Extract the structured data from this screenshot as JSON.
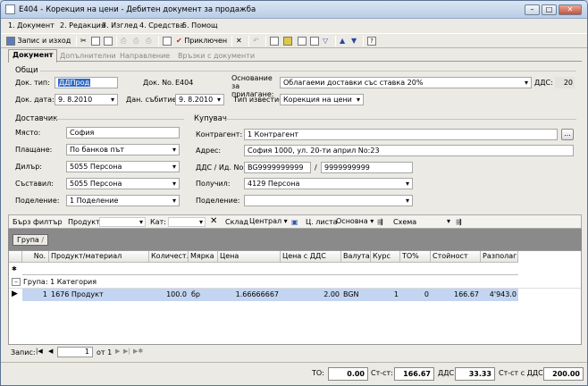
{
  "window": {
    "title": "E404 - Корекция на цени - Дебитен документ за продажба"
  },
  "menu": [
    "1. Документ",
    "2. Редакция",
    "3. Изглед",
    "4. Средства",
    "5. Помощ"
  ],
  "toolbar": {
    "save_exit": "Запис и изход",
    "apply": "Приключен"
  },
  "tabs": [
    "Документ",
    "Допълнителни",
    "Направление",
    "Връзки с документи"
  ],
  "general": {
    "section": "Общи",
    "doc_type_label": "Док. тип:",
    "doc_type_value": "ДДПрод",
    "doc_no_label": "Док. No.",
    "doc_no_value": "E404",
    "basis_label": "Основание за прилагане:",
    "basis_value": "Облагаеми доставки със ставка 20%",
    "vat_label": "ДДС:",
    "vat_value": "20",
    "doc_date_label": "Док. дата:",
    "doc_date_value": "9. 8.2010",
    "event_date_label": "Дан. събитие:",
    "event_date_value": "9. 8.2010",
    "notice_label": "Тип известие:",
    "notice_value": "Корекция на цени"
  },
  "supplier": {
    "section": "Доставчик",
    "place_label": "Място:",
    "place_value": "София",
    "payment_label": "Плащане:",
    "payment_value": "По банков път",
    "dealer_label": "Дилър:",
    "dealer_value": "5055 Персона",
    "compiler_label": "Съставил:",
    "compiler_value": "5055 Персона",
    "division_label": "Поделение:",
    "division_value": "1 Поделение"
  },
  "buyer": {
    "section": "Купувач",
    "contractor_label": "Контрагент:",
    "contractor_value": "1 Контрагент",
    "address_label": "Адрес:",
    "address_value": "София 1000, ул. 20-ти април No:23",
    "vatid_label": "ДДС / Ид. No.",
    "vat_no": "BG9999999999",
    "id_no": "9999999999",
    "slash": "/",
    "receiver_label": "Получил:",
    "receiver_value": "4129 Персона",
    "division_label": "Поделение:",
    "division_value": "",
    "ellipsis": "..."
  },
  "filter": {
    "quick": "Бърз филтър",
    "product": "Продукт:",
    "cat": "Кат:",
    "warehouse": "Склад",
    "warehouse_value": "Централ",
    "price_list": "Ц. листа",
    "price_list_value": "Основна",
    "scheme": "Схема"
  },
  "group_chip": "Група",
  "grid": {
    "columns": [
      "No.",
      "Продукт/материал",
      "Количест...",
      "Мярка",
      "Цена",
      "Цена с ДДС",
      "Валута",
      "Курс",
      "ТО%",
      "Стойност",
      "Разполаг..."
    ],
    "group_row": "Група: 1 Категория",
    "rows": [
      {
        "no": "1",
        "product": "1676 Продукт",
        "qty": "100.0",
        "unit": "бр",
        "price": "1.66666667",
        "price_vat": "2.00",
        "currency": "BGN",
        "rate": "1",
        "to": "0",
        "value": "166.67",
        "avail": "4'943.0"
      }
    ]
  },
  "pager": {
    "label": "Запис:",
    "current": "1",
    "of": "от 1"
  },
  "totals": {
    "to_label": "ТО:",
    "to_value": "0.00",
    "sum_label": "Ст-ст:",
    "sum_value": "166.67",
    "vat_label": "ДДС:",
    "vat_value": "33.33",
    "total_label": "Ст-ст с ДДС:",
    "total_value": "200.00"
  }
}
